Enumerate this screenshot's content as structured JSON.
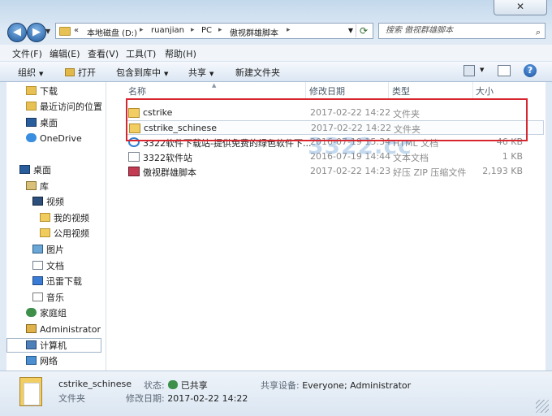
{
  "address": {
    "crumbs": [
      "«",
      "本地磁盘 (D:)",
      "ruanjian",
      "PC",
      "傲视群雄脚本"
    ],
    "search_placeholder": "搜索 傲视群雄脚本"
  },
  "menu": [
    "文件(F)",
    "编辑(E)",
    "查看(V)",
    "工具(T)",
    "帮助(H)"
  ],
  "commands": {
    "organize": "组织",
    "open": "打开",
    "include_in_library": "包含到库中",
    "share": "共享",
    "new_folder": "新建文件夹"
  },
  "nav_pane": {
    "favorites": [
      "下载",
      "最近访问的位置",
      "桌面",
      "OneDrive"
    ],
    "desktop": "桌面",
    "libraries": "库",
    "videos": "视频",
    "my_videos": "我的视频",
    "public_videos": "公用视频",
    "pictures": "图片",
    "documents": "文档",
    "xunlei": "迅雷下载",
    "music": "音乐",
    "homegroup": "家庭组",
    "admin": "Administrator",
    "computer": "计算机",
    "network": "网络"
  },
  "columns": {
    "name": "名称",
    "date": "修改日期",
    "type": "类型",
    "size": "大小"
  },
  "files": [
    {
      "name": "cstrike",
      "date": "2017-02-22 14:22",
      "type": "文件夹",
      "size": "",
      "icon": "folder"
    },
    {
      "name": "cstrike_schinese",
      "date": "2017-02-22 14:22",
      "type": "文件夹",
      "size": "",
      "icon": "folder"
    },
    {
      "name": "3322软件下载站-提供免费的绿色软件下...",
      "date": "2016-07-19 15:34",
      "type": "HTML 文档",
      "size": "46 KB",
      "icon": "ie"
    },
    {
      "name": "3322软件站",
      "date": "2016-07-19 14:44",
      "type": "文本文档",
      "size": "1 KB",
      "icon": "txt"
    },
    {
      "name": "傲视群雄脚本",
      "date": "2017-02-22 14:23",
      "type": "好压 ZIP 压缩文件",
      "size": "2,193 KB",
      "icon": "zip"
    }
  ],
  "watermark": "3322.cc",
  "details": {
    "name": "cstrike_schinese",
    "kind": "文件夹",
    "state_label": "状态:",
    "state_value": "已共享",
    "modified_label": "修改日期:",
    "modified_value": "2017-02-22 14:22",
    "shared_label": "共享设备:",
    "shared_value": "Everyone; Administrator"
  }
}
